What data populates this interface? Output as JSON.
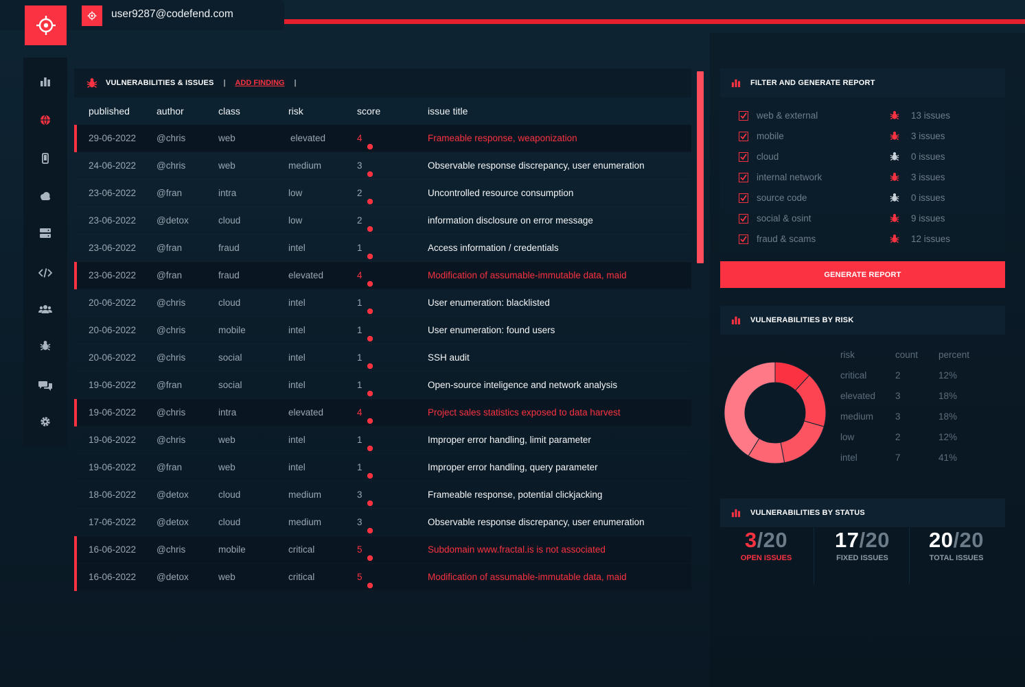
{
  "header": {
    "user_email": "user9287@codefend.com"
  },
  "sidebar": {
    "items": [
      {
        "icon": "bar-chart-icon",
        "active": false
      },
      {
        "icon": "globe-icon",
        "active": true
      },
      {
        "icon": "mobile-icon",
        "active": false
      },
      {
        "icon": "cloud-icon",
        "active": false
      },
      {
        "icon": "server-icon",
        "active": false
      },
      {
        "icon": "code-icon",
        "active": false
      },
      {
        "icon": "users-icon",
        "active": false
      },
      {
        "icon": "bug-icon",
        "active": false
      },
      {
        "icon": "chat-icon",
        "active": false
      },
      {
        "icon": "gear-icon",
        "active": false
      }
    ]
  },
  "vulns": {
    "title": "VULNERABILITIES & ISSUES",
    "separator": "|",
    "add_finding": "ADD FINDING",
    "columns": [
      "published",
      "author",
      "class",
      "risk",
      "score",
      "issue title"
    ],
    "rows": [
      {
        "published": "29-06-2022",
        "author": "@chris",
        "class": "web",
        "risk": "elevated",
        "score": "4",
        "title": "Frameable response, weaponization",
        "highlight": true
      },
      {
        "published": "24-06-2022",
        "author": "@chris",
        "class": "web",
        "risk": "medium",
        "score": "3",
        "title": "Observable response discrepancy, user enumeration",
        "highlight": false
      },
      {
        "published": "23-06-2022",
        "author": "@fran",
        "class": "intra",
        "risk": "low",
        "score": "2",
        "title": "Uncontrolled resource consumption",
        "highlight": false
      },
      {
        "published": "23-06-2022",
        "author": "@detox",
        "class": "cloud",
        "risk": "low",
        "score": "2",
        "title": "information disclosure on error message",
        "highlight": false
      },
      {
        "published": "23-06-2022",
        "author": "@fran",
        "class": "fraud",
        "risk": "intel",
        "score": "1",
        "title": "Access information / credentials",
        "highlight": false
      },
      {
        "published": "23-06-2022",
        "author": "@fran",
        "class": "fraud",
        "risk": "elevated",
        "score": "4",
        "title": "Modification of assumable-immutable data, maid",
        "highlight": true
      },
      {
        "published": "20-06-2022",
        "author": "@chris",
        "class": "cloud",
        "risk": "intel",
        "score": "1",
        "title": "User enumeration: blacklisted",
        "highlight": false
      },
      {
        "published": "20-06-2022",
        "author": "@chris",
        "class": "mobile",
        "risk": "intel",
        "score": "1",
        "title": "User enumeration: found users",
        "highlight": false
      },
      {
        "published": "20-06-2022",
        "author": "@chris",
        "class": "social",
        "risk": "intel",
        "score": "1",
        "title": "SSH audit",
        "highlight": false
      },
      {
        "published": "19-06-2022",
        "author": "@fran",
        "class": "social",
        "risk": "intel",
        "score": "1",
        "title": "Open-source inteligence and network analysis",
        "highlight": false
      },
      {
        "published": "19-06-2022",
        "author": "@chris",
        "class": "intra",
        "risk": "elevated",
        "score": "4",
        "title": "Project sales statistics exposed to data harvest",
        "highlight": true
      },
      {
        "published": "19-06-2022",
        "author": "@chris",
        "class": "web",
        "risk": "intel",
        "score": "1",
        "title": "Improper error handling, limit parameter",
        "highlight": false
      },
      {
        "published": "19-06-2022",
        "author": "@fran",
        "class": "web",
        "risk": "intel",
        "score": "1",
        "title": "Improper error handling, query parameter",
        "highlight": false
      },
      {
        "published": "18-06-2022",
        "author": "@detox",
        "class": "cloud",
        "risk": "medium",
        "score": "3",
        "title": "Frameable response, potential clickjacking",
        "highlight": false
      },
      {
        "published": "17-06-2022",
        "author": "@detox",
        "class": "cloud",
        "risk": "medium",
        "score": "3",
        "title": "Observable response discrepancy, user enumeration",
        "highlight": false
      },
      {
        "published": "16-06-2022",
        "author": "@chris",
        "class": "mobile",
        "risk": "critical",
        "score": "5",
        "title": "Subdomain www.fractal.is is not associated",
        "highlight": true
      },
      {
        "published": "16-06-2022",
        "author": "@detox",
        "class": "web",
        "risk": "critical",
        "score": "5",
        "title": "Modification of assumable-immutable data, maid",
        "highlight": true
      }
    ]
  },
  "filter": {
    "title": "FILTER AND GENERATE REPORT",
    "items": [
      {
        "label": "web & external",
        "count": "13 issues",
        "active_bug": true
      },
      {
        "label": "mobile",
        "count": "3 issues",
        "active_bug": true
      },
      {
        "label": "cloud",
        "count": "0 issues",
        "active_bug": false
      },
      {
        "label": "internal network",
        "count": "3 issues",
        "active_bug": true
      },
      {
        "label": "source code",
        "count": "0 issues",
        "active_bug": false
      },
      {
        "label": "social & osint",
        "count": "9 issues",
        "active_bug": true
      },
      {
        "label": "fraud & scams",
        "count": "12 issues",
        "active_bug": true
      }
    ],
    "button": "GENERATE REPORT"
  },
  "risk": {
    "title": "VULNERABILITIES BY RISK",
    "headers": [
      "risk",
      "count",
      "percent"
    ],
    "rows": [
      {
        "risk": "critical",
        "count": "2",
        "percent": "12%"
      },
      {
        "risk": "elevated",
        "count": "3",
        "percent": "18%"
      },
      {
        "risk": "medium",
        "count": "3",
        "percent": "18%"
      },
      {
        "risk": "low",
        "count": "2",
        "percent": "12%"
      },
      {
        "risk": "intel",
        "count": "7",
        "percent": "41%"
      }
    ]
  },
  "chart_data": {
    "type": "pie",
    "categories": [
      "critical",
      "elevated",
      "medium",
      "low",
      "intel"
    ],
    "values": [
      2,
      3,
      3,
      2,
      7
    ],
    "colors": [
      "#fb3241",
      "#fc4452",
      "#fd5462",
      "#fe6673",
      "#ff7a86"
    ]
  },
  "status": {
    "title": "VULNERABILITIES BY STATUS",
    "items": [
      {
        "num": "3",
        "den": "/20",
        "label": "OPEN ISSUES",
        "red": true
      },
      {
        "num": "17",
        "den": "/20",
        "label": "FIXED ISSUES",
        "red": false
      },
      {
        "num": "20",
        "den": "/20",
        "label": "TOTAL ISSUES",
        "red": false
      }
    ]
  },
  "colors": {
    "accent": "#fb3241",
    "background": "#0e2433",
    "panel": "#0b1b28"
  }
}
